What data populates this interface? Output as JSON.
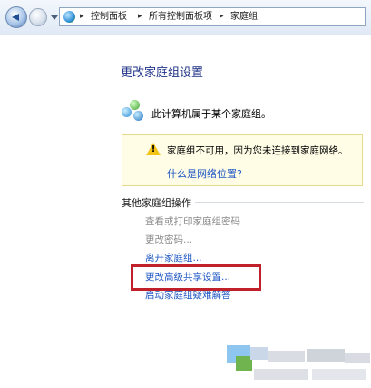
{
  "address_bar": {
    "crumbs": [
      "控制面板",
      "所有控制面板项",
      "家庭组"
    ],
    "separators": [
      "▸",
      "▸",
      "▸"
    ]
  },
  "page": {
    "title": "更改家庭组设置",
    "homegroup_status": "此计算机属于某个家庭组。"
  },
  "warning": {
    "mark": "!",
    "message": "家庭组不可用，因为您未连接到家庭网络。",
    "link": "什么是网络位置?"
  },
  "other_actions": {
    "heading": "其他家庭组操作",
    "items": [
      {
        "label": "查看或打印家庭组密码",
        "enabled": false
      },
      {
        "label": "更改密码...",
        "enabled": false
      },
      {
        "label": "离开家庭组...",
        "enabled": true
      },
      {
        "label": "更改高级共享设置...",
        "enabled": true
      },
      {
        "label": "启动家庭组疑难解答",
        "enabled": true
      }
    ]
  },
  "colors": {
    "highlight_box": "#c0202a",
    "link": "#1f57c3",
    "title": "#1e3287"
  }
}
